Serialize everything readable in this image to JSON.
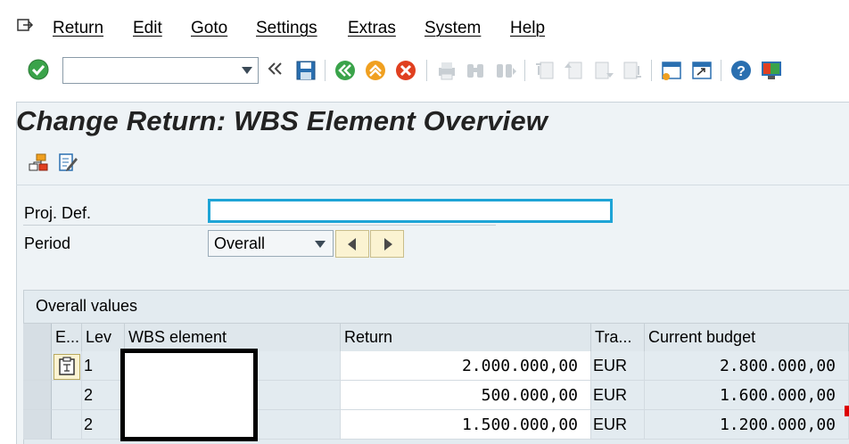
{
  "menu": {
    "items": [
      "Return",
      "Edit",
      "Goto",
      "Settings",
      "Extras",
      "System",
      "Help"
    ]
  },
  "toolbar": {
    "command_field_value": "",
    "icons": [
      "enter-icon",
      "save-icon",
      "back-icon",
      "exit-icon",
      "cancel-icon",
      "print-icon",
      "find-icon",
      "find-next-icon",
      "first-page-icon",
      "previous-page-icon",
      "next-page-icon",
      "last-page-icon",
      "create-session-icon",
      "shortcut-icon",
      "help-icon",
      "customize-layout-icon"
    ]
  },
  "screen": {
    "title": "Change Return: WBS Element Overview"
  },
  "form": {
    "proj_def_label": "Proj. Def.",
    "proj_def_value": "",
    "period_label": "Period",
    "period_value": "Overall"
  },
  "table": {
    "title": "Overall values",
    "headers": {
      "e": "E...",
      "lev": "Lev",
      "wbs": "WBS element",
      "return": "Return",
      "currency": "Tra...",
      "budget": "Current budget"
    },
    "rows": [
      {
        "lev": "1",
        "wbs": "",
        "return": "2.000.000,00",
        "currency": "EUR",
        "budget": "2.800.000,00"
      },
      {
        "lev": "2",
        "wbs": "",
        "return": "500.000,00",
        "currency": "EUR",
        "budget": "1.600.000,00"
      },
      {
        "lev": "2",
        "wbs": "",
        "return": "1.500.000,00",
        "currency": "EUR",
        "budget": "1.200.000,00"
      }
    ]
  },
  "colors": {
    "accent_focus": "#1ea4d6",
    "background": "#eef3f6",
    "nav_button": "#fbf3d2"
  }
}
